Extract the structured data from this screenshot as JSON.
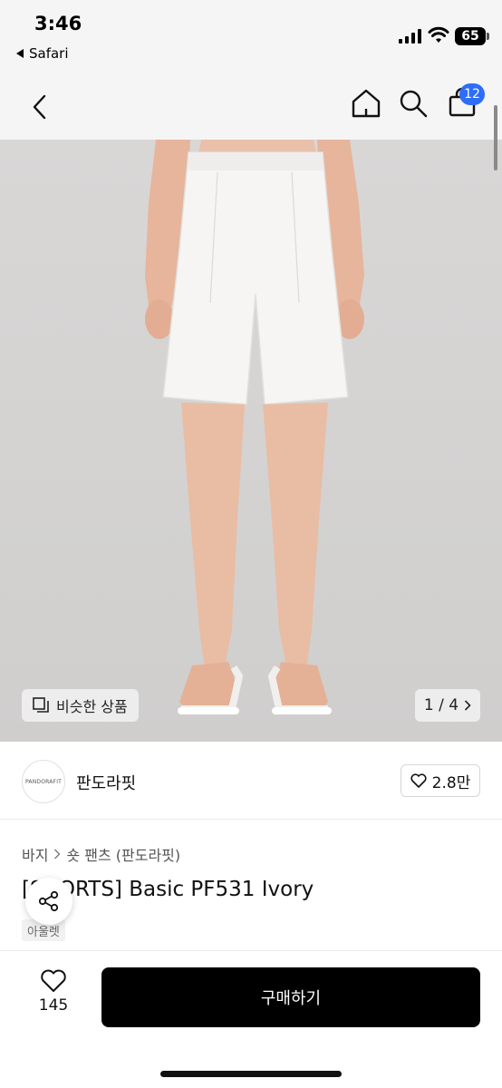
{
  "status_bar": {
    "time": "3:46",
    "back_app": "Safari",
    "battery": "65"
  },
  "header": {
    "cart_count": "12",
    "icons": [
      "back-chevron-icon",
      "home-icon",
      "search-icon",
      "shopping-bag-icon"
    ]
  },
  "gallery": {
    "similar_label": "비슷한 상품",
    "pager": "1 / 4",
    "colors": {
      "background": "#d6d5d4",
      "shorts": "#f4f3f1",
      "skin": "#e8b8a0"
    }
  },
  "brand": {
    "logo_text": "PANDORAFIT",
    "name": "판도라핏",
    "likes": "2.8만"
  },
  "product": {
    "category": [
      "바지",
      "숏 팬츠 (판도라핏)"
    ],
    "title": "[SHORTS] Basic PF531 Ivory",
    "sub_tag": "아울렛"
  },
  "bottom": {
    "favorite_count": "145",
    "buy_label": "구매하기"
  },
  "colors": {
    "accent_badge": "#2f6df6",
    "buy_button": "#000000"
  }
}
